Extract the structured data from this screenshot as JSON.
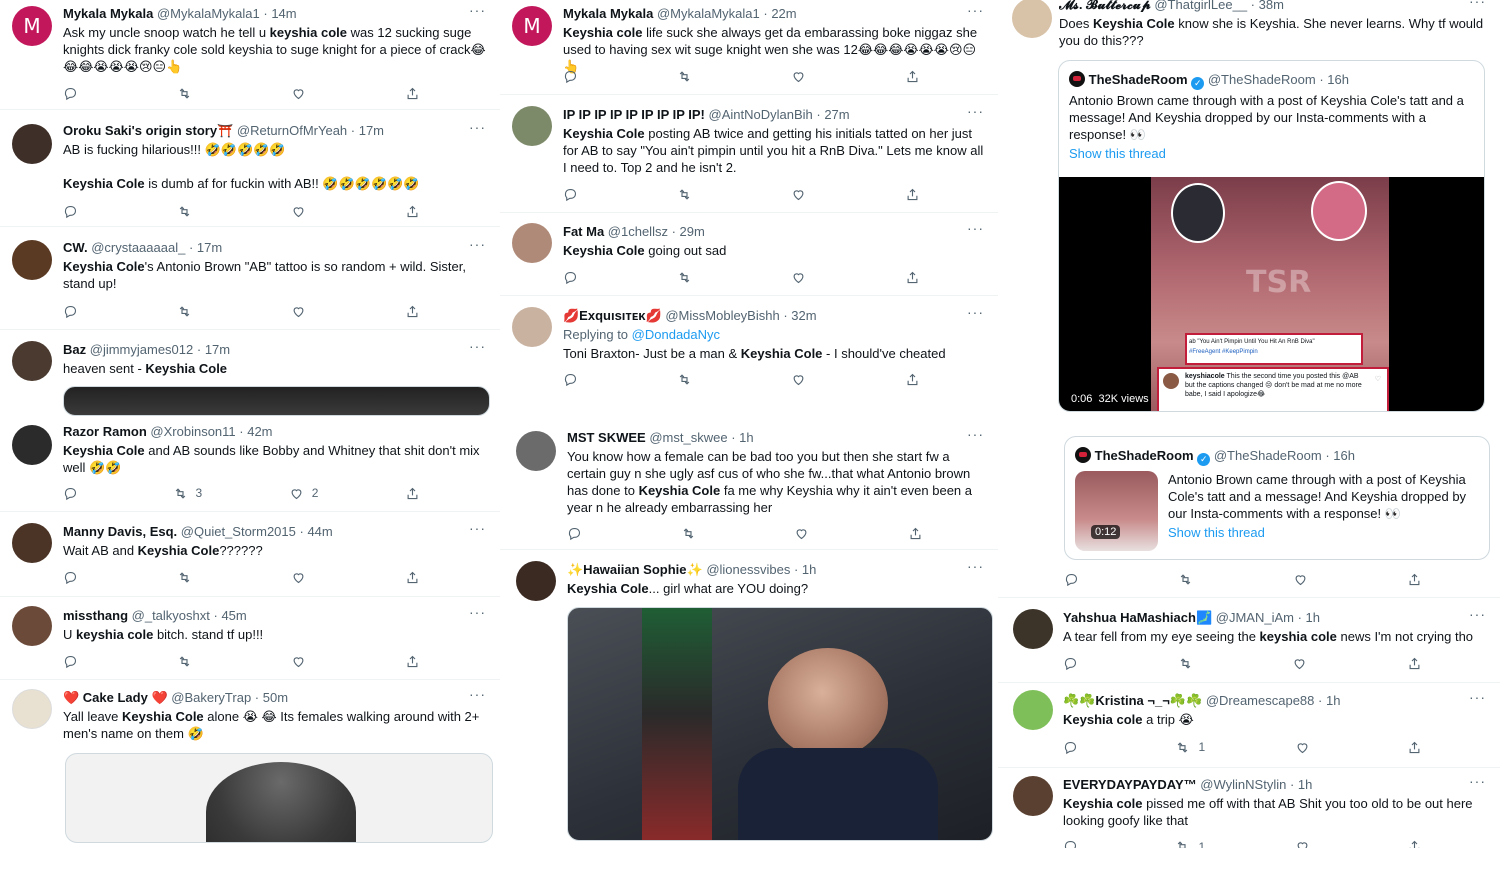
{
  "columns": {
    "left": {
      "tweets": [
        {
          "name": "Mykala Mykala",
          "handle": "@MykalaMykala1",
          "time": "14m",
          "text": "Ask my uncle snoop watch he tell u keyshia cole was 12 sucking suge knights dick franky cole sold keyshia to suge knight for a piece of crack😂😂😂😭😭😭😢😑👆",
          "reply": "",
          "retweet": "",
          "like": ""
        },
        {
          "name": "Oroku Saki's origin story⛩️",
          "handle": "@ReturnOfMrYeah",
          "time": "17m",
          "text": "AB is fucking hilarious!!! 🤣🤣🤣🤣🤣\n\nKeyshia Cole is dumb af for fuckin with AB!! 🤣🤣🤣🤣🤣🤣",
          "reply": "",
          "retweet": "",
          "like": ""
        },
        {
          "name": "CW.",
          "handle": "@crystaaaaaal_",
          "time": "17m",
          "text": "Keyshia Cole's Antonio Brown \"AB\" tattoo is so random + wild. Sister, stand up!",
          "reply": "",
          "retweet": "",
          "like": ""
        },
        {
          "name": "Baz",
          "handle": "@jimmyjames012",
          "time": "17m",
          "text": "heaven sent - Keyshia Cole"
        },
        {
          "name": "Razor Ramon",
          "handle": "@Xrobinson11",
          "time": "42m",
          "text": "Keyshia Cole and AB sounds like Bobby and Whitney that shit don't mix well 🤣🤣",
          "reply": "",
          "retweet": "3",
          "like": "2"
        },
        {
          "name": "Manny Davis, Esq.",
          "handle": "@Quiet_Storm2015",
          "time": "44m",
          "text": "Wait AB and Keyshia Cole??????",
          "reply": "",
          "retweet": "",
          "like": ""
        },
        {
          "name": "missthang",
          "handle": "@_talkyoshxt",
          "time": "45m",
          "text": "U keyshia cole bitch. stand tf up!!!",
          "reply": "",
          "retweet": "",
          "like": ""
        },
        {
          "name": "❤️ Cake Lady ❤️",
          "handle": "@BakeryTrap",
          "time": "50m",
          "text": "Yall leave Keyshia Cole alone 😭 😂 Its females walking around with 2+ men's name on them 🤣"
        }
      ]
    },
    "middle": {
      "tweets": [
        {
          "name": "Mykala Mykala",
          "handle": "@MykalaMykala1",
          "time": "22m",
          "text": "Keyshia cole life suck she always get da embarassing boke niggaz she used to having sex wit suge knight wen she was 12😂😂😂😭😭😭😢😑👆",
          "reply": "",
          "retweet": "",
          "like": ""
        },
        {
          "name": "IP IP IP IP IP IP IP IP IP!",
          "handle": "@AintNoDylanBih",
          "time": "27m",
          "text": "Keyshia Cole posting AB twice and getting his initials tatted on her just for AB to say \"You ain't pimpin until you hit a RnB Diva.\" Lets me know all I need to. Top 2 and he isn't 2.",
          "reply": "",
          "retweet": "",
          "like": ""
        },
        {
          "name": "Fat Ma",
          "handle": "@1chellsz",
          "time": "29m",
          "text": "Keyshia Cole going out sad",
          "reply": "",
          "retweet": "",
          "like": ""
        },
        {
          "name": "💋Exquısıᴛᴇκ💋",
          "handle": "@MissMobleyBishh",
          "time": "32m",
          "replying_prefix": "Replying to",
          "replying_to": "@DondadaNyc",
          "text": "Toni Braxton- Just be a man & Keyshia Cole - I should've cheated",
          "reply": "",
          "retweet": "",
          "like": ""
        },
        {
          "name": "MST SKWEE",
          "handle": "@mst_skwee",
          "time": "1h",
          "text": "You know how a female can be bad too you but then she start fw a certain guy n she ugly asf cus of who she fw...that what Antonio brown has done to Keyshia Cole fa me why Keyshia why it ain't even been a year n he already embarrassing her",
          "reply": "",
          "retweet": "",
          "like": ""
        },
        {
          "name": "✨Hawaiian Sophie✨",
          "handle": "@lionessvibes",
          "time": "1h",
          "text": "Keyshia Cole... girl what are YOU doing?"
        }
      ]
    },
    "right": {
      "tweets": [
        {
          "name": "𝓜𝓼. 𝓑𝓾𝓽𝓽𝓮𝓻𝓬𝓾𝓹",
          "handle": "@ThatgirlLee__",
          "time": "38m",
          "text": "Does Keyshia Cole know she is Keyshia. She never learns. Why tf would you do this???",
          "quote": {
            "name": "TheShadeRoom",
            "handle": "@TheShadeRoom",
            "time": "16h",
            "text": "Antonio Brown came through with a post of Keyshia Cole's tatt and a message! And Keyshia dropped by our Insta-comments with a response! 👀",
            "thread": "Show this thread",
            "video": {
              "duration": "0:06",
              "views": "32K views",
              "caption1": "ab \"You Ain't Pimpin Until You Hit An RnB Diva\"",
              "caption2": "#FreeAgent #KeepPimpin",
              "comment_user": "keyshiacole",
              "comment_text": "This the second time you posted this @AB but the captions changed 😒 don't be mad at me no more babe, I said I apologize😂",
              "watermark": "TSR"
            }
          }
        },
        {
          "quote": {
            "name": "TheShadeRoom",
            "handle": "@TheShadeRoom",
            "time": "16h",
            "text": "Antonio Brown came through with a post of Keyshia Cole's tatt and a message! And Keyshia dropped by our Insta-comments with a response! 👀",
            "thread": "Show this thread",
            "duration": "0:12"
          },
          "reply": "",
          "retweet": "",
          "like": ""
        },
        {
          "name": "Yahshua HaMashiach🗾",
          "handle": "@JMAN_iAm",
          "time": "1h",
          "text": "A tear fell from my eye seeing the keyshia cole news I'm not crying tho",
          "reply": "",
          "retweet": "",
          "like": ""
        },
        {
          "name": "☘️☘️Kristina ¬_¬☘️☘️",
          "handle": "@Dreamescape88",
          "time": "1h",
          "text": "Keyshia cole a trip 😭",
          "reply": "",
          "retweet": "1",
          "like": ""
        },
        {
          "name": "EVERYDAYPAYDAY™",
          "handle": "@WylinNStylin",
          "time": "1h",
          "text": "Keyshia cole pissed me off with that AB Shit you too old to be out here looking goofy like that",
          "reply": "",
          "retweet": "1",
          "like": ""
        }
      ]
    }
  },
  "labels": {
    "more": "···"
  },
  "colors": {
    "accent": "#1d9bf0",
    "muted": "#536471",
    "border": "#eff3f4",
    "avatar_m": "#c2185b",
    "tsr_red": "#d4223a"
  }
}
